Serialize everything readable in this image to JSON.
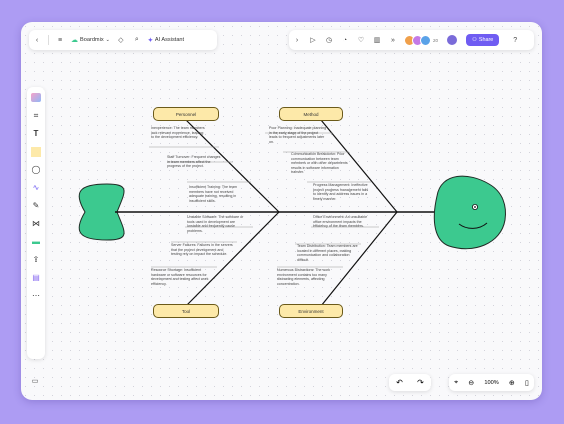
{
  "toolbar": {
    "board_name": "Boardmix",
    "ai_label": "AI Assistant",
    "avatar_count": "20",
    "share_label": "Share"
  },
  "colors": {
    "accent": "#6f5cf2",
    "label_fill": "#fde9a9",
    "fish": "#3cc98f"
  },
  "categories": {
    "personnel": "Personnel",
    "method": "Method",
    "tool": "Tool",
    "environment": "Environment"
  },
  "causes": {
    "c1": "Inexperience: The team members lack relevant experience, leading to the development efficiency.",
    "c2": "Staff Turnover: Frequent changes in team members affect the progress of the project.",
    "c3": "Insufficient Training: The team members have not received adequate training, resulting in insufficient skills.",
    "c4": "Poor Planning: Inadequate planning in the early stage of the project leads to frequent adjustments later on.",
    "c5": "Communication Breakdown: Poor communication between team members or with other departments results in software information transfer.",
    "c6": "Progress Management: Ineffective project progress management fails to identify and address issues in a timely manner.",
    "c7": "Unstable Software: The software or tools used in development are unstable and frequently cause problems.",
    "c8": "Server Failures: Failures in the servers that the project development and testing rely on impact the schedule.",
    "c9": "Resource Shortage: Insufficient hardware or software resources for development and testing affect work efficiency.",
    "c10": "Office Environment: An unsuitable office environment impacts the efficiency of the team members.",
    "c11": "Team Distribution: Team members are located in different places, making communication and collaboration difficult.",
    "c12": "Numerous Distractions: The work environment contains too many distracting elements, affecting concentration."
  },
  "bottom": {
    "zoom_level": "100%"
  }
}
